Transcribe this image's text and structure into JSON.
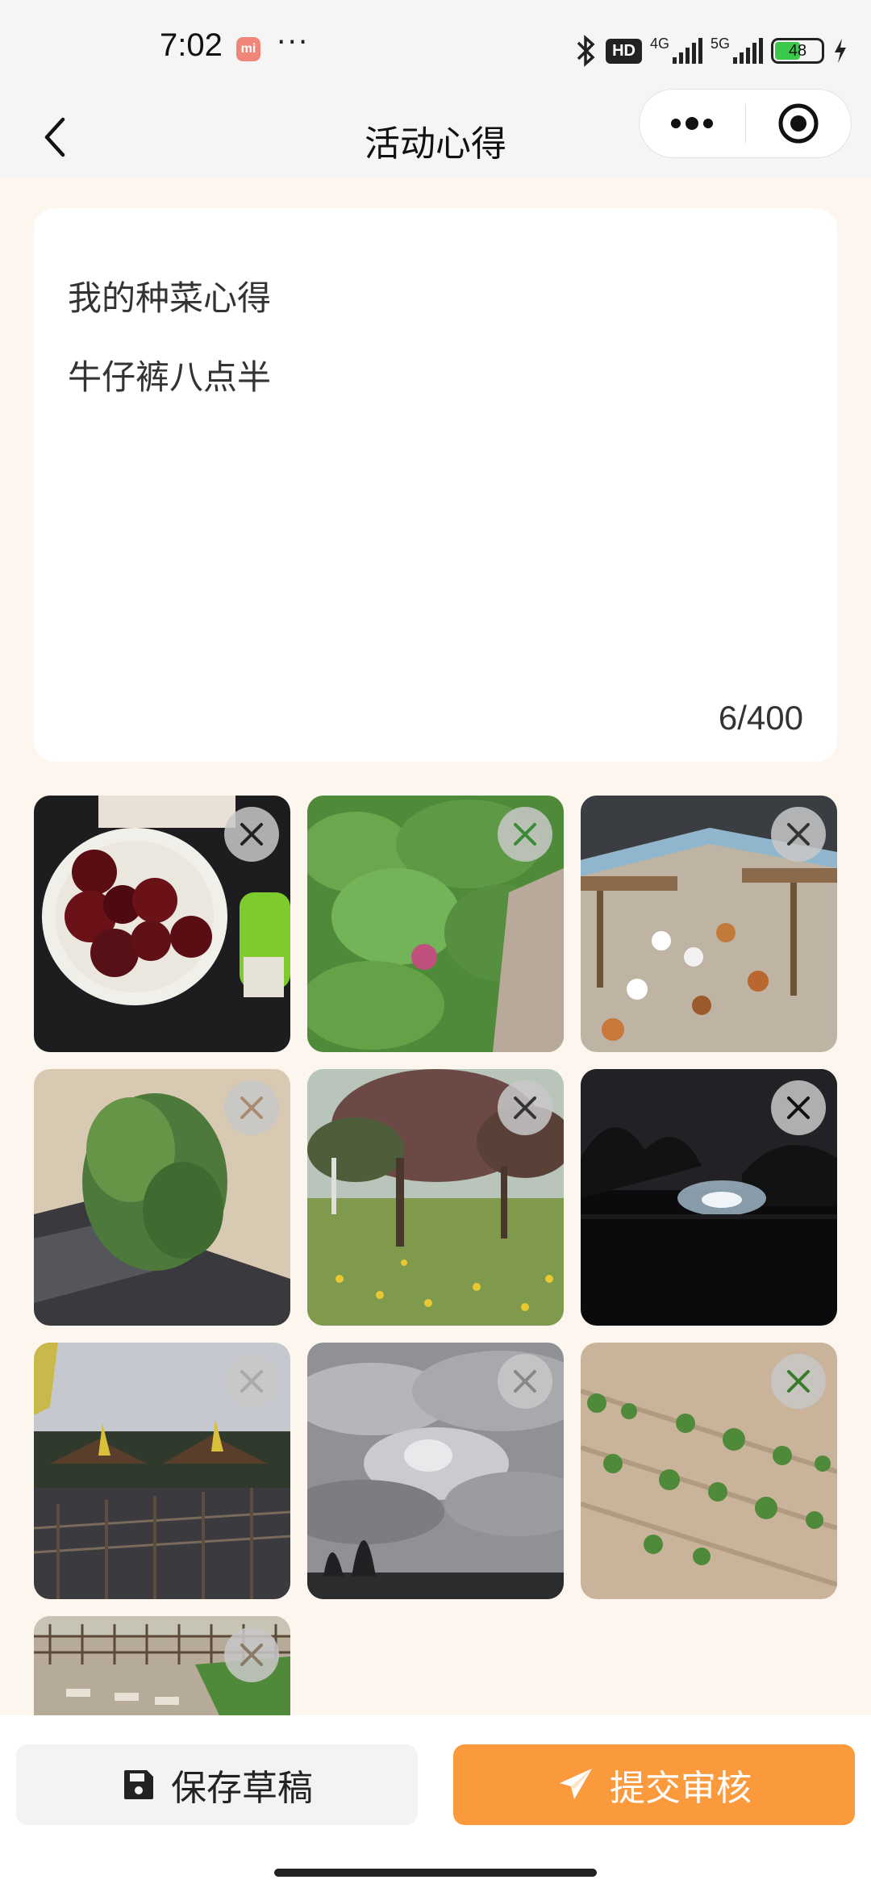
{
  "status_bar": {
    "time": "7:02",
    "mi_badge": "mi",
    "dots": "···",
    "hd": "HD",
    "net1": "4G",
    "net2": "5G",
    "battery": "48"
  },
  "nav": {
    "title": "活动心得",
    "icons": {
      "back": "back-arrow-icon",
      "more": "more-dots-icon",
      "target": "target-icon"
    }
  },
  "note": {
    "lines": [
      "我的种菜心得",
      "牛仔裤八点半"
    ],
    "counter": "6/400"
  },
  "photos": [
    {
      "subject": "cherries in bowl"
    },
    {
      "subject": "green plant with purple flower"
    },
    {
      "subject": "chickens in greenhouse"
    },
    {
      "subject": "tomato plant on mulch"
    },
    {
      "subject": "trees and yellow flowers"
    },
    {
      "subject": "night scene with light"
    },
    {
      "subject": "huts and fence at dusk"
    },
    {
      "subject": "cloudy sky"
    },
    {
      "subject": "seedlings in soil"
    },
    {
      "subject": "garden plot with fence"
    }
  ],
  "actions": {
    "draft_label": "保存草稿",
    "submit_label": "提交审核",
    "submit_color": "#fb9a3d",
    "draft_color": "#f2f3f5"
  }
}
